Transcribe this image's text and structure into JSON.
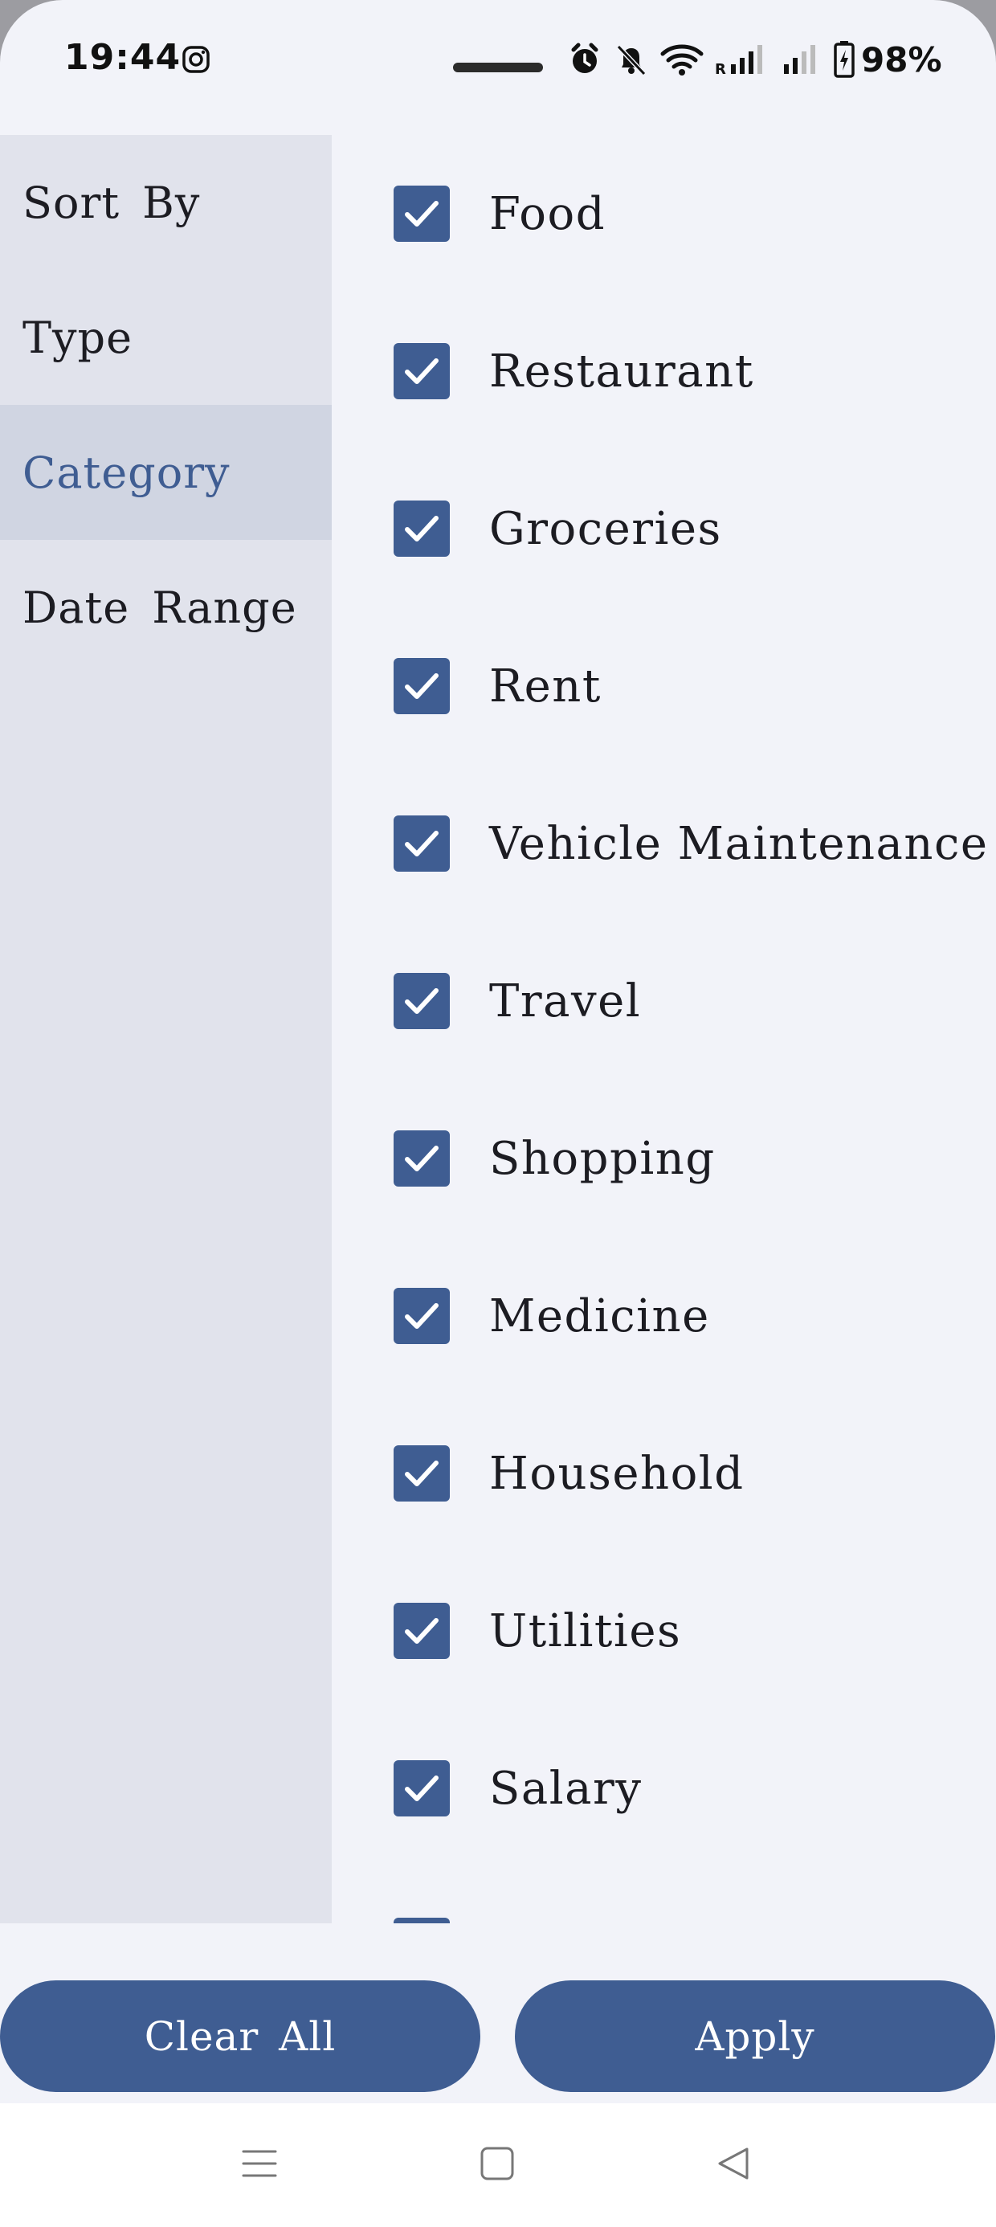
{
  "status_bar": {
    "time": "19:44",
    "battery": "98%",
    "icons": [
      "instagram-icon",
      "alarm-icon",
      "bell-off-icon",
      "wifi-icon",
      "signal-roaming-icon",
      "signal-icon",
      "battery-charging-icon"
    ]
  },
  "sidebar": {
    "items": [
      {
        "label": "Sort By",
        "active": false
      },
      {
        "label": "Type",
        "active": false
      },
      {
        "label": "Category",
        "active": true
      },
      {
        "label": "Date Range",
        "active": false
      }
    ]
  },
  "categories": [
    {
      "label": "Food",
      "checked": true
    },
    {
      "label": "Restaurant",
      "checked": true
    },
    {
      "label": "Groceries",
      "checked": true
    },
    {
      "label": "Rent",
      "checked": true
    },
    {
      "label": "Vehicle Maintenance",
      "checked": true
    },
    {
      "label": "Travel",
      "checked": true
    },
    {
      "label": "Shopping",
      "checked": true
    },
    {
      "label": "Medicine",
      "checked": true
    },
    {
      "label": "Household",
      "checked": true
    },
    {
      "label": "Utilities",
      "checked": true
    },
    {
      "label": "Salary",
      "checked": true
    },
    {
      "label": "",
      "checked": true
    }
  ],
  "actions": {
    "clear_label": "Clear All",
    "apply_label": "Apply"
  },
  "navbar": {
    "icons": [
      "menu-icon",
      "home-square-icon",
      "back-triangle-icon"
    ]
  },
  "colors": {
    "accent": "#3f5d92",
    "background": "#f2f3f9",
    "sidebar": "#e1e3ec",
    "sidebar_active": "#d0d5e2"
  }
}
